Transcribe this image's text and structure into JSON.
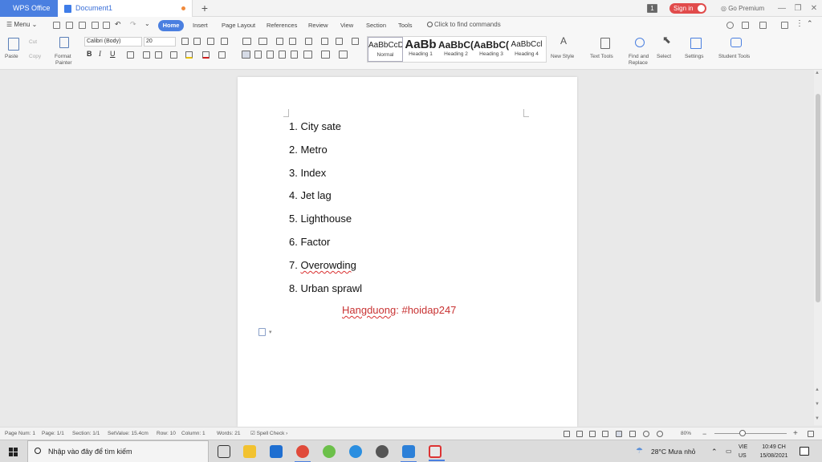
{
  "titlebar": {
    "app_tab": "WPS Office",
    "doc_tab": "Document1",
    "new_tab": "+",
    "window_count": "1",
    "sign_in": "Sign in",
    "go_premium": "Go Premium",
    "minimize": "—",
    "restore": "❐",
    "close": "✕"
  },
  "menu": {
    "menu_label": "Menu",
    "tabs": [
      "Home",
      "Insert",
      "Page Layout",
      "References",
      "Review",
      "View",
      "Section",
      "Tools"
    ],
    "search_placeholder": "Click to find commands"
  },
  "ribbon": {
    "paste": "Paste",
    "cut": "Cut",
    "copy": "Copy",
    "format_painter_1": "Format",
    "format_painter_2": "Painter",
    "font_name": "Calibri (Body)",
    "font_size": "20",
    "bold": "B",
    "italic": "I",
    "underline": "U",
    "styles": [
      {
        "sample": "AaBbCcDı",
        "name": "Normal"
      },
      {
        "sample": "AaBb",
        "name": "Heading 1"
      },
      {
        "sample": "AaBbC(",
        "name": "Heading 2"
      },
      {
        "sample": "AaBbC(",
        "name": "Heading 3"
      },
      {
        "sample": "AaBbCcl",
        "name": "Heading 4"
      }
    ],
    "new_style": "New Style",
    "text_tools": "Text Tools",
    "find_replace_1": "Find and",
    "find_replace_2": "Replace",
    "select": "Select",
    "settings": "Settings",
    "student_tools": "Student Tools"
  },
  "document": {
    "items": [
      "1. City sate",
      "2. Metro",
      "3. Index",
      "4. Jet lag",
      "5. Lighthouse",
      "6. Factor",
      "7. Overowding",
      "8. Urban sprawl"
    ],
    "item7_prefix": "7. ",
    "item7_word": "Overowding",
    "signature_name": "Hangduong",
    "signature_tag": ": #hoidap247"
  },
  "statusbar": {
    "page_num": "Page Num: 1",
    "page": "Page: 1/1",
    "section": "Section: 1/1",
    "set_value": "SetValue: 15.4cm",
    "row": "Row: 10",
    "column": "Column: 1",
    "words": "Words: 21",
    "spell_check": "Spell Check",
    "zoom": "80%",
    "zoom_minus": "−",
    "zoom_plus": "+"
  },
  "taskbar": {
    "search_placeholder": "Nhập vào đây để tìm kiếm",
    "weather": "28°C  Mưa nhỏ",
    "lang_1": "VIE",
    "lang_2": "US",
    "time": "10:49 CH",
    "date": "15/08/2021"
  },
  "colors": {
    "accent": "#4a7fe0",
    "signin": "#e14b4b",
    "signature": "#c83232",
    "spell_error": "#d93030"
  }
}
